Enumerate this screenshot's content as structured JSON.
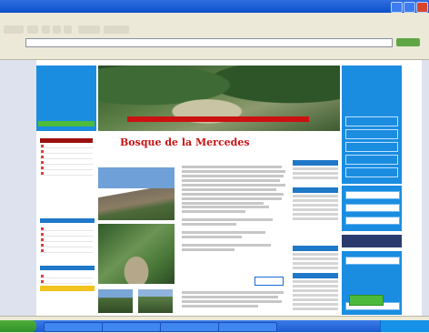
{
  "window": {
    "title": ""
  },
  "menu": {
    "items": [
      "",
      "",
      "",
      "",
      "",
      ""
    ]
  },
  "address": {
    "label": "",
    "url": "",
    "go": ""
  },
  "links": {
    "label": "",
    "items": [
      "",
      "",
      ""
    ]
  },
  "page": {
    "headline": "Bosque de la Mercedes",
    "banner_caption": "",
    "left_heading": "",
    "right_heading": "",
    "more_button": "",
    "green_button": ""
  },
  "taskbar": {
    "start": "",
    "tasks": [
      "",
      "",
      "",
      ""
    ],
    "clock": ""
  },
  "colors": {
    "accent_blue": "#1a8de0",
    "headline_red": "#c81414",
    "taskbar_blue": "#1e5bd0",
    "start_green": "#33912a",
    "nav_dark_red": "#9b1010"
  },
  "icons": [
    "back-icon",
    "forward-icon",
    "stop-icon",
    "refresh-icon",
    "home-icon",
    "search-icon",
    "favorites-icon",
    "go-icon",
    "windows-logo-icon"
  ]
}
